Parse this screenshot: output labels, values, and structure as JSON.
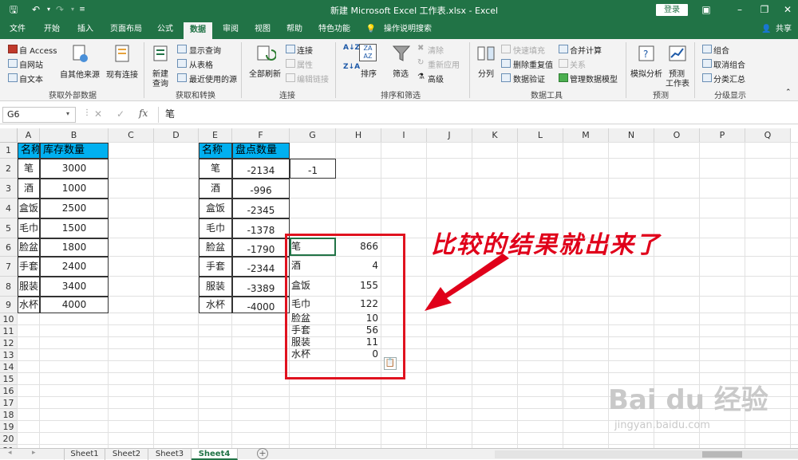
{
  "app": {
    "title": "新建 Microsoft Excel 工作表.xlsx  -  Excel",
    "login": "登录",
    "share": "共享",
    "tell_me": "操作说明搜索"
  },
  "tabs": [
    "文件",
    "开始",
    "插入",
    "页面布局",
    "公式",
    "数据",
    "审阅",
    "视图",
    "帮助",
    "特色功能"
  ],
  "active_tab": "数据",
  "ribbon": {
    "get_external": {
      "label": "获取外部数据",
      "access": "自 Access",
      "web": "自网站",
      "text": "自文本",
      "other": "自其他来源",
      "existing": "现有连接"
    },
    "get_transform": {
      "label": "获取和转换",
      "new_query": "新建",
      "new_query2": "查询",
      "show_queries": "显示查询",
      "from_table": "从表格",
      "recent": "最近使用的源"
    },
    "connections": {
      "label": "连接",
      "refresh_all": "全部刷新",
      "connections": "连接",
      "properties": "属性",
      "edit_links": "编辑链接"
    },
    "sort_filter": {
      "label": "排序和筛选",
      "sort": "排序",
      "filter": "筛选",
      "clear": "清除",
      "reapply": "重新应用",
      "advanced": "高级"
    },
    "data_tools": {
      "label": "数据工具",
      "text_to_col": "分列",
      "flash_fill": "快速填充",
      "remove_dup": "删除重复值",
      "validation": "数据验证",
      "consolidate": "合并计算",
      "relations": "关系",
      "manage_model": "管理数据模型"
    },
    "forecast": {
      "label": "预测",
      "what_if": "模拟分析",
      "forecast_sheet": "预测",
      "forecast_sheet2": "工作表"
    },
    "outline": {
      "label": "分级显示",
      "group": "组合",
      "ungroup": "取消组合",
      "subtotal": "分类汇总"
    }
  },
  "formula_bar": {
    "name_box": "G6",
    "formula": "笔"
  },
  "columns": [
    "A",
    "B",
    "C",
    "D",
    "E",
    "F",
    "G",
    "H",
    "I",
    "J",
    "K",
    "L",
    "M",
    "N",
    "O",
    "P",
    "Q"
  ],
  "rows": [
    "1",
    "2",
    "3",
    "4",
    "5",
    "6",
    "7",
    "8",
    "9",
    "10",
    "11",
    "12",
    "13",
    "14",
    "15",
    "16",
    "17",
    "18",
    "19",
    "20",
    "21"
  ],
  "table1": {
    "headers": [
      "名称",
      "库存数量"
    ],
    "rows": [
      [
        "笔",
        "3000"
      ],
      [
        "酒",
        "1000"
      ],
      [
        "盒饭",
        "2500"
      ],
      [
        "毛巾",
        "1500"
      ],
      [
        "脸盆",
        "1800"
      ],
      [
        "手套",
        "2400"
      ],
      [
        "服装",
        "3400"
      ],
      [
        "水杯",
        "4000"
      ]
    ]
  },
  "table2": {
    "headers": [
      "名称",
      "盘点数量"
    ],
    "rows": [
      [
        "笔",
        "-2134"
      ],
      [
        "酒",
        "-996"
      ],
      [
        "盒饭",
        "-2345"
      ],
      [
        "毛巾",
        "-1378"
      ],
      [
        "脸盆",
        "-1790"
      ],
      [
        "手套",
        "-2344"
      ],
      [
        "服装",
        "-3389"
      ],
      [
        "水杯",
        "-4000"
      ]
    ]
  },
  "g2_value": "-1",
  "result": {
    "rows": [
      [
        "笔",
        "866"
      ],
      [
        "酒",
        "4"
      ],
      [
        "盒饭",
        "155"
      ],
      [
        "毛巾",
        "122"
      ],
      [
        "脸盆",
        "10"
      ],
      [
        "手套",
        "56"
      ],
      [
        "服装",
        "11"
      ],
      [
        "水杯",
        "0"
      ]
    ]
  },
  "annotation": "比较的结果就出来了",
  "sheets": [
    "Sheet1",
    "Sheet2",
    "Sheet3",
    "Sheet4"
  ],
  "active_sheet": "Sheet4",
  "watermark": "Bai du 经验",
  "watermark_url": "jingyan.baidu.com",
  "colors": {
    "excel_green": "#217346",
    "header_fill": "#00b0f0",
    "annotation_red": "#e0001a"
  }
}
